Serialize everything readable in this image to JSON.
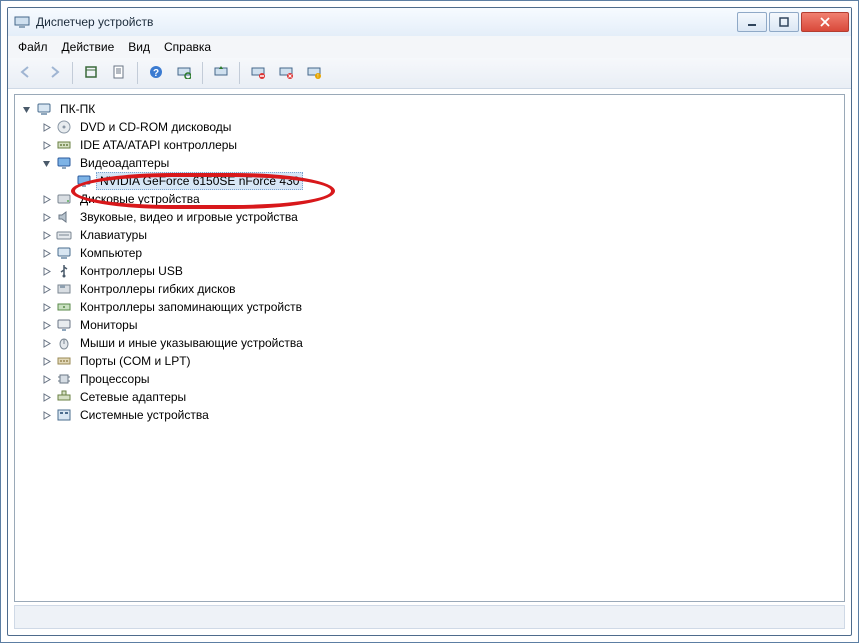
{
  "window": {
    "title": "Диспетчер устройств"
  },
  "menu": {
    "file": "Файл",
    "action": "Действие",
    "view": "Вид",
    "help": "Справка"
  },
  "toolbar": [
    {
      "name": "back",
      "enabled": false
    },
    {
      "name": "forward",
      "enabled": false
    },
    {
      "sep": true
    },
    {
      "name": "show-hidden",
      "enabled": true
    },
    {
      "name": "properties-sheet",
      "enabled": true
    },
    {
      "sep": true
    },
    {
      "name": "help",
      "enabled": true
    },
    {
      "name": "scan-hardware",
      "enabled": true
    },
    {
      "sep": true
    },
    {
      "name": "update-driver",
      "enabled": true
    },
    {
      "sep": true
    },
    {
      "name": "uninstall",
      "enabled": true
    },
    {
      "name": "disable",
      "enabled": true
    },
    {
      "name": "enable",
      "enabled": true
    }
  ],
  "tree": {
    "root": {
      "label": "ПК-ПК",
      "icon": "computer",
      "expanded": true
    },
    "children": [
      {
        "label": "DVD и CD-ROM дисководы",
        "icon": "disc",
        "expanded": false
      },
      {
        "label": "IDE ATA/ATAPI контроллеры",
        "icon": "ide",
        "expanded": false
      },
      {
        "label": "Видеоадаптеры",
        "icon": "display",
        "expanded": true,
        "children": [
          {
            "label": "NVIDIA GeForce 6150SE nForce 430",
            "icon": "display",
            "selected": true
          }
        ]
      },
      {
        "label": "Дисковые устройства",
        "icon": "drive",
        "expanded": false
      },
      {
        "label": "Звуковые, видео и игровые устройства",
        "icon": "sound",
        "expanded": false
      },
      {
        "label": "Клавиатуры",
        "icon": "keyboard",
        "expanded": false
      },
      {
        "label": "Компьютер",
        "icon": "computer",
        "expanded": false
      },
      {
        "label": "Контроллеры USB",
        "icon": "usb",
        "expanded": false
      },
      {
        "label": "Контроллеры гибких дисков",
        "icon": "floppyc",
        "expanded": false
      },
      {
        "label": "Контроллеры запоминающих устройств",
        "icon": "storage",
        "expanded": false
      },
      {
        "label": "Мониторы",
        "icon": "monitor",
        "expanded": false
      },
      {
        "label": "Мыши и иные указывающие устройства",
        "icon": "mouse",
        "expanded": false
      },
      {
        "label": "Порты (COM и LPT)",
        "icon": "port",
        "expanded": false
      },
      {
        "label": "Процессоры",
        "icon": "cpu",
        "expanded": false
      },
      {
        "label": "Сетевые адаптеры",
        "icon": "network",
        "expanded": false
      },
      {
        "label": "Системные устройства",
        "icon": "system",
        "expanded": false
      }
    ]
  }
}
